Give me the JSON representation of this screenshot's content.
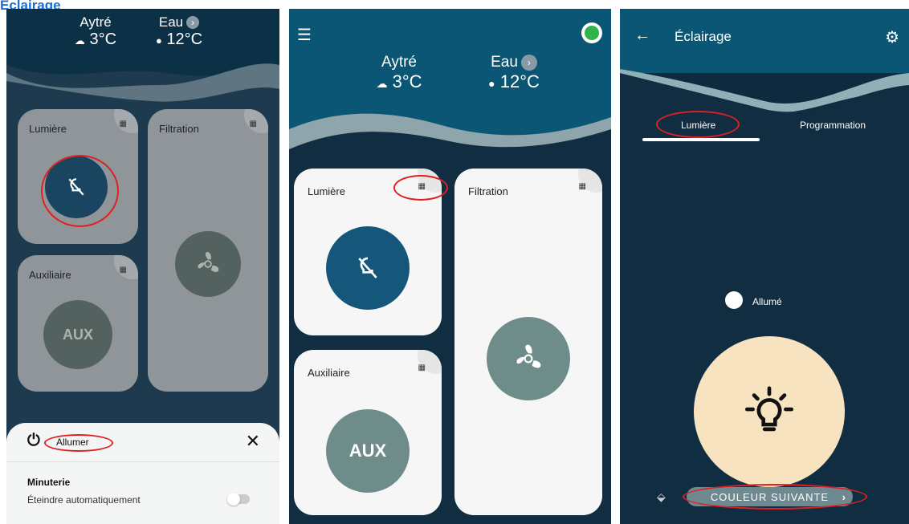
{
  "section_heading": "Éclairage",
  "weather": {
    "place": "Aytré",
    "air_temp": "3°C",
    "water_label": "Eau",
    "water_temp": "12°C"
  },
  "cards": {
    "lumiere": "Lumière",
    "filtration": "Filtration",
    "auxiliaire": "Auxiliaire",
    "aux_button": "AUX"
  },
  "sheet": {
    "action": "Allumer",
    "timer_title": "Minuterie",
    "auto_off": "Éteindre automatiquement",
    "auto_off_enabled": false
  },
  "detail": {
    "title": "Éclairage",
    "tabs": [
      "Lumière",
      "Programmation"
    ],
    "active_tab": 0,
    "state_label": "Allumé",
    "next_color": "COULEUR SUIVANTE"
  },
  "colors": {
    "dark_bg": "#0d2d43",
    "teal_button": "#14577a",
    "grey_button": "#6e8c8a",
    "light_peach": "#f7e3c0",
    "status_dot": "#2fb34a",
    "highlight": "#e02020"
  }
}
